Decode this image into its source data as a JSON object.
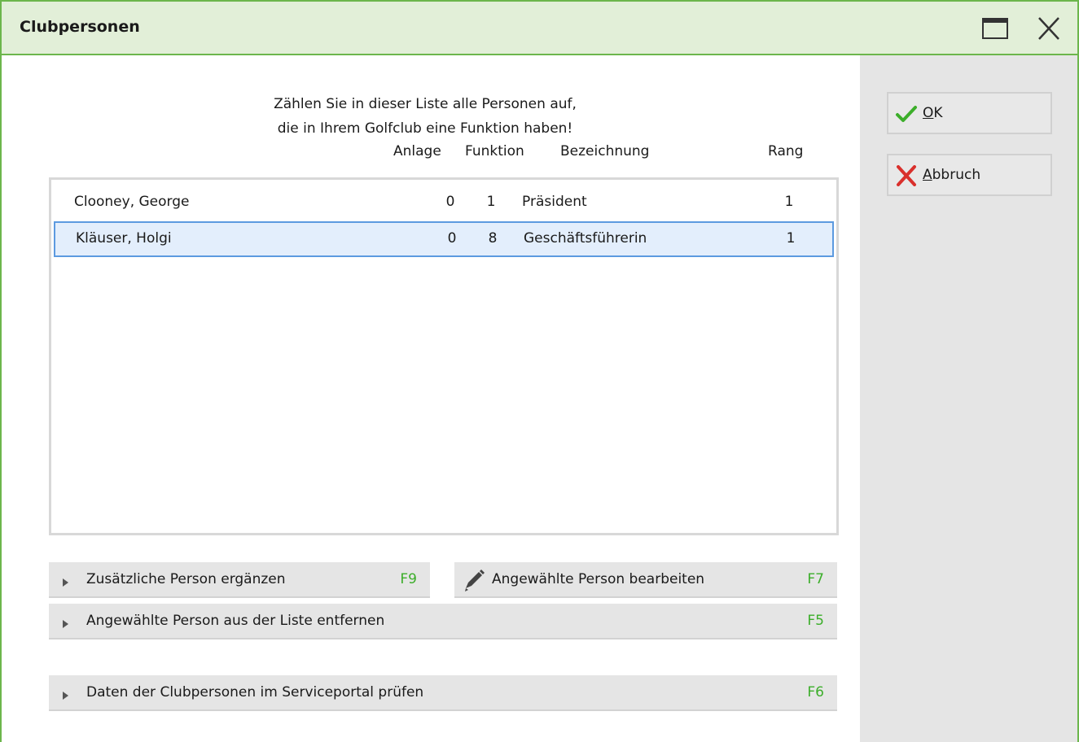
{
  "window": {
    "title": "Clubpersonen"
  },
  "intro": {
    "line1": "Zählen Sie in dieser Liste alle Personen auf,",
    "line2": "die in Ihrem Golfclub eine Funktion haben!"
  },
  "columns": {
    "anlage": "Anlage",
    "funktion": "Funktion",
    "bezeichnung": "Bezeichnung",
    "rang": "Rang"
  },
  "rows": [
    {
      "name": "Clooney, George",
      "anlage": "0",
      "funktion": "1",
      "bezeichnung": "Präsident",
      "rang": "1",
      "selected": false
    },
    {
      "name": "Kläuser, Holgi",
      "anlage": "0",
      "funktion": "8",
      "bezeichnung": "Geschäftsführerin",
      "rang": "1",
      "selected": true
    }
  ],
  "actions": {
    "add": {
      "label": "Zusätzliche Person ergänzen",
      "key": "F9"
    },
    "edit": {
      "label": "Angewählte Person bearbeiten",
      "key": "F7"
    },
    "remove": {
      "label": "Angewählte Person aus der Liste entfernen",
      "key": "F5"
    },
    "check": {
      "label": "Daten der Clubpersonen im Serviceportal prüfen",
      "key": "F6"
    }
  },
  "side": {
    "ok_mnemonic": "O",
    "ok_rest": "K",
    "cancel_mnemonic": "A",
    "cancel_rest": "bbruch"
  },
  "colors": {
    "accent_green": "#6cb64c",
    "key_green": "#3cae2a",
    "cancel_red": "#d9302c",
    "selection_border": "#5c9ae0"
  },
  "icons": [
    "maximize-icon",
    "close-icon",
    "triangle-right-icon",
    "pencil-icon",
    "checkmark-icon",
    "x-mark-icon"
  ]
}
